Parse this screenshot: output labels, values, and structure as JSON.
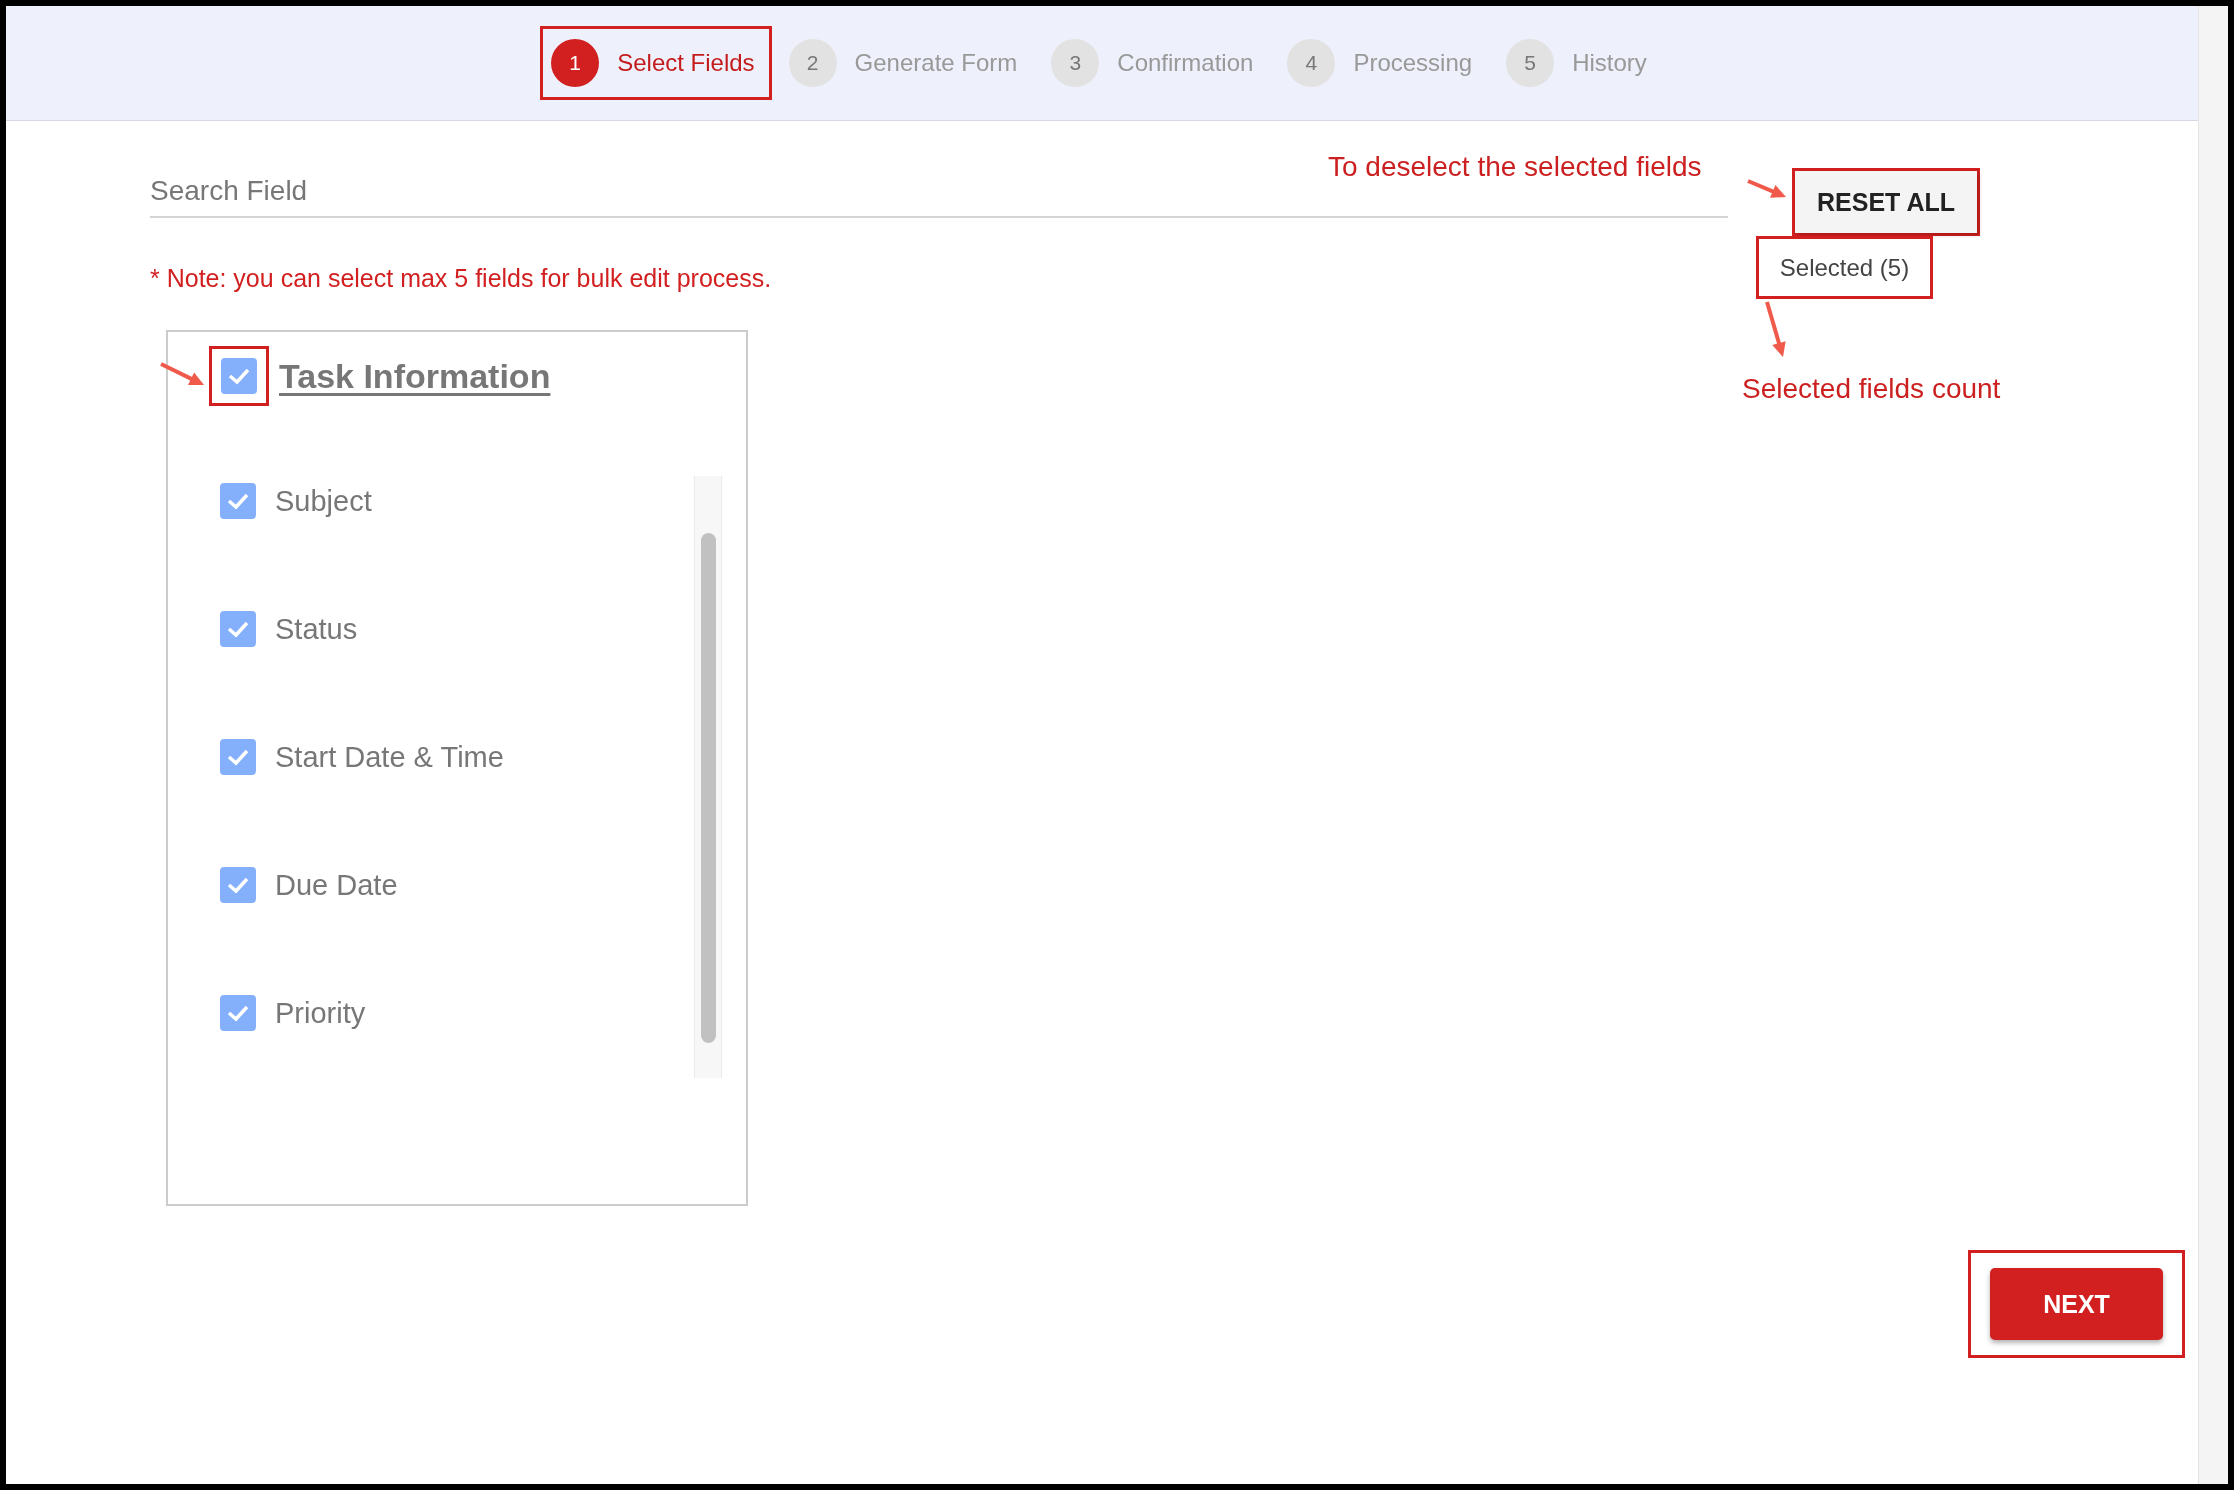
{
  "steps": [
    {
      "number": "1",
      "label": "Select Fields",
      "selected": true,
      "highlighted": true
    },
    {
      "number": "2",
      "label": "Generate Form",
      "selected": false,
      "highlighted": false
    },
    {
      "number": "3",
      "label": "Confirmation",
      "selected": false,
      "highlighted": false
    },
    {
      "number": "4",
      "label": "Processing",
      "selected": false,
      "highlighted": false
    },
    {
      "number": "5",
      "label": "History",
      "selected": false,
      "highlighted": false
    }
  ],
  "search": {
    "placeholder": "Search Field"
  },
  "note": "* Note: you can select max 5 fields for bulk edit process.",
  "reset_button": {
    "label": "RESET ALL",
    "highlighted": true
  },
  "selected_count": {
    "text": "Selected (5)",
    "highlighted": true
  },
  "group": {
    "title": "Task Information",
    "checked": true,
    "highlighted": true,
    "fields": [
      {
        "label": "Subject",
        "checked": true
      },
      {
        "label": "Status",
        "checked": true
      },
      {
        "label": "Start Date & Time",
        "checked": true
      },
      {
        "label": "Due Date",
        "checked": true
      },
      {
        "label": "Priority",
        "checked": true
      }
    ]
  },
  "next_button": {
    "label": "NEXT",
    "highlighted": true
  },
  "annotations": [
    {
      "text": "To deselect the selected fields"
    },
    {
      "text": "Selected fields count"
    }
  ]
}
